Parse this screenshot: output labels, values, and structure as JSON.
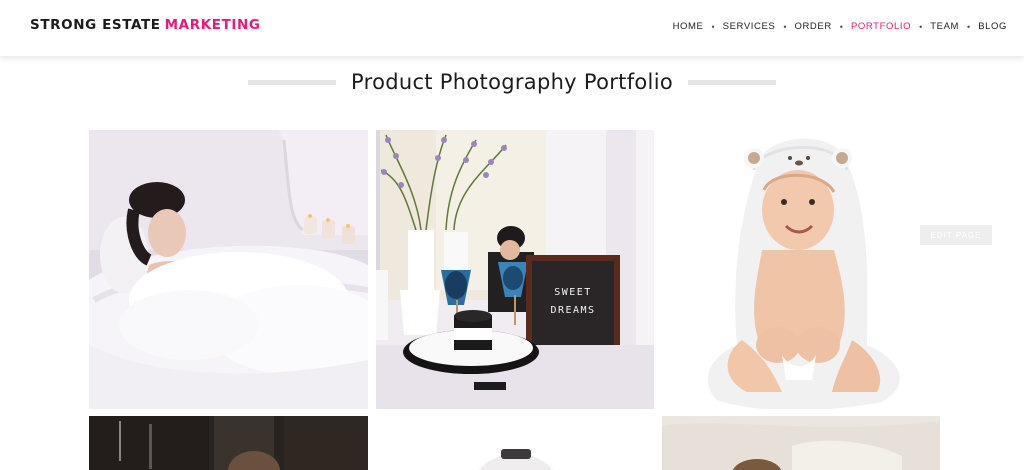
{
  "brand": {
    "name": "STRONG ESTATE",
    "accent": "MARKETING",
    "accent_color": "#e8197a"
  },
  "nav": {
    "items": [
      {
        "label": "HOME",
        "active": false
      },
      {
        "label": "SERVICES",
        "active": false
      },
      {
        "label": "ORDER",
        "active": false
      },
      {
        "label": "PORTFOLIO",
        "active": true
      },
      {
        "label": "TEAM",
        "active": false
      },
      {
        "label": "BLOG",
        "active": false
      }
    ],
    "separator": "•"
  },
  "page": {
    "title": "Product Photography Portfolio"
  },
  "letter_board": {
    "line1": "SWEET",
    "line2": "DREAMS"
  },
  "admin": {
    "edit_label": "EDIT PAGE"
  },
  "gallery": {
    "items": [
      {
        "name": "bath-photo"
      },
      {
        "name": "vanity-photo"
      },
      {
        "name": "baby-towel-photo"
      },
      {
        "name": "kitchen-photo"
      },
      {
        "name": "product-photo"
      },
      {
        "name": "bedding-photo"
      }
    ]
  }
}
